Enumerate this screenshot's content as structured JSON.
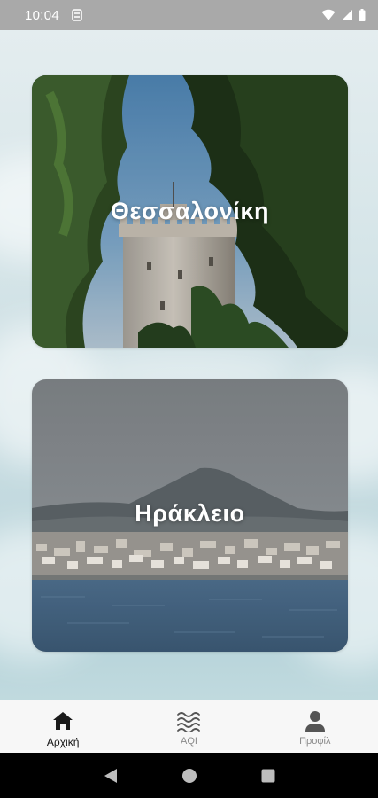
{
  "status_bar": {
    "time": "10:04",
    "icons": [
      "app-notification-icon",
      "wifi-icon",
      "signal-icon",
      "battery-icon"
    ]
  },
  "cities": [
    {
      "name": "Θεσσαλονίκη",
      "image": "white-tower-photo"
    },
    {
      "name": "Ηράκλειο",
      "image": "heraklion-harbor-photo"
    }
  ],
  "bottom_nav": {
    "items": [
      {
        "label": "Αρχική",
        "icon": "home-icon",
        "active": true
      },
      {
        "label": "AQI",
        "icon": "waves-icon",
        "active": false
      },
      {
        "label": "Προφίλ",
        "icon": "person-icon",
        "active": false
      }
    ]
  },
  "system_nav": {
    "buttons": [
      "back-button",
      "home-button",
      "recents-button"
    ]
  },
  "colors": {
    "status_bar_bg": "#a9a9a9",
    "nav_bg": "#f7f7f7",
    "active_label": "#111111",
    "inactive_label": "#8a8a8a",
    "system_nav_bg": "#000000"
  }
}
